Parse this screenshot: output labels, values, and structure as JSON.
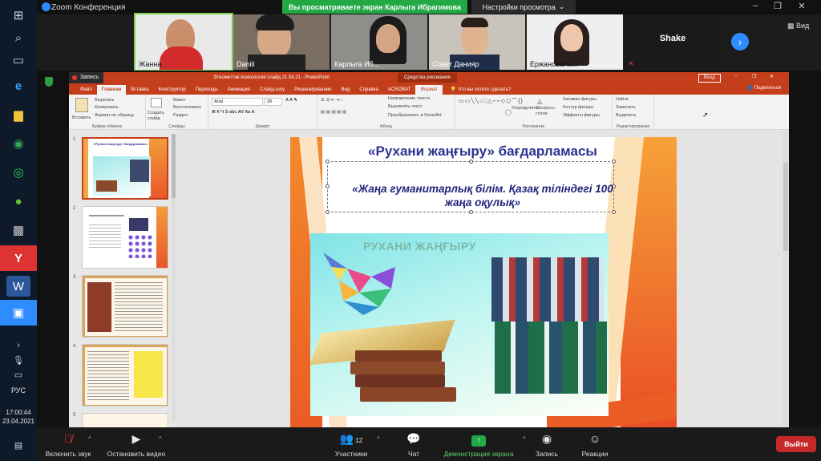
{
  "taskbar": {
    "language": "РУС",
    "time": "17:00:44",
    "date": "23.04.2021"
  },
  "zoom": {
    "window_title": "Zoom Конференция",
    "share_banner": "Вы просматриваете экран Карлыга Ибрагимова",
    "view_options": "Настройки просмотра",
    "grid_view_label": "Вид",
    "participants_tiles": [
      {
        "name": "Жанна"
      },
      {
        "name": "Daniil"
      },
      {
        "name": "Карлыга Иб..."
      },
      {
        "name": "Совет Данияр"
      },
      {
        "name": "ЕржановаАк..."
      },
      {
        "name": "Shake"
      }
    ],
    "toolbar": {
      "unmute": "Включить звук",
      "stop_video": "Остановить видео",
      "participants": "Участники",
      "participants_count": "12",
      "chat": "Чат",
      "share": "Демонстрация экрана",
      "record": "Запись",
      "reactions": "Реакции",
      "leave": "Выйти"
    }
  },
  "ppt": {
    "recording_label": "Запись",
    "title": "Этнометтик психология слайд 21.04.21 - PowerPoint",
    "context_header": "Средства рисования",
    "sign_in": "Вход",
    "tabs": [
      "Файл",
      "Главная",
      "Вставка",
      "Конструктор",
      "Переходы",
      "Анимация",
      "Слайд-шоу",
      "Рецензирование",
      "Вид",
      "Справка",
      "ACROBAT",
      "Формат"
    ],
    "tell_me": "Что вы хотите сделать?",
    "share": "Поделиться",
    "ribbon": {
      "clipboard": {
        "label": "Буфер обмена",
        "paste": "Вставить",
        "cut": "Вырезать",
        "copy": "Копировать",
        "format_painter": "Формат по образцу"
      },
      "slides": {
        "label": "Слайды",
        "new_slide": "Создать слайд",
        "layout": "Макет",
        "reset": "Восстановить",
        "section": "Раздел"
      },
      "font": {
        "label": "Шрифт",
        "font_name": "Arial",
        "font_size": "28"
      },
      "paragraph": {
        "label": "Абзац",
        "text_direction": "Направление текста",
        "align_text": "Выровнять текст",
        "smartart": "Преобразовать в SmartArt"
      },
      "drawing": {
        "label": "Рисование",
        "arrange": "Упорядочить",
        "quick_styles": "Экспресс-стили",
        "fill": "Заливка фигуры",
        "outline": "Контур фигуры",
        "effects": "Эффекты фигуры"
      },
      "editing": {
        "label": "Редактирование",
        "find": "Найти",
        "replace": "Заменить",
        "select": "Выделить"
      }
    },
    "thumbnails": [
      {
        "num": "1",
        "title": "«Рухани жаңғыру» бағдарламасы"
      },
      {
        "num": "2",
        "title": ""
      },
      {
        "num": "3",
        "title": ""
      },
      {
        "num": "4",
        "title": ""
      },
      {
        "num": "5",
        "title": ""
      }
    ],
    "slide": {
      "title": "«Рухани жаңғыру» бағдарламасы",
      "subtitle": "«Жаңа гуманитарлық білім. Қазақ тіліндегі 100 жаңа оқулық»",
      "image_text": "РУХАНИ ЖАҢҒЫРУ"
    }
  },
  "colors": {
    "ppt_accent": "#c43e1c",
    "zoom_green": "#23a846",
    "zoom_blue": "#2d8cff",
    "leave_red": "#c62828",
    "slide_title": "#2e3192"
  }
}
